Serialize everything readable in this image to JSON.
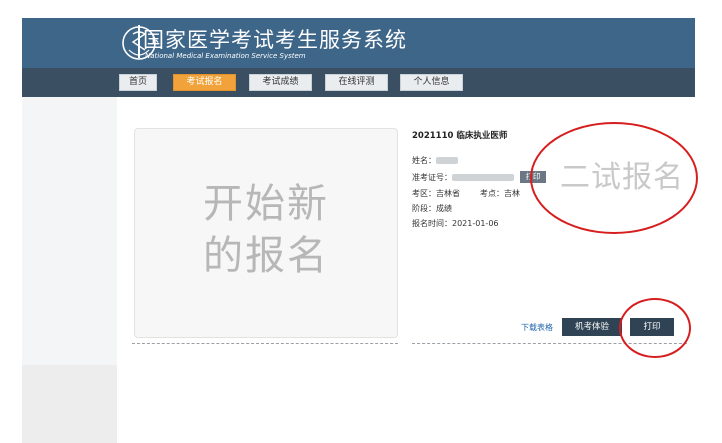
{
  "header": {
    "title_cn": "国家医学考试考生服务系统",
    "title_en": "National Medical Examination Service System"
  },
  "nav": {
    "items": [
      {
        "label": "首页",
        "active": false
      },
      {
        "label": "考试报名",
        "active": true
      },
      {
        "label": "考试成绩",
        "active": false
      },
      {
        "label": "在线评测",
        "active": false
      },
      {
        "label": "个人信息",
        "active": false
      }
    ]
  },
  "new_registration": {
    "line1": "开始新",
    "line2": "的报名"
  },
  "exam": {
    "title": "2021110 临床执业医师",
    "name_label": "姓名：",
    "admission_label": "准考证号：",
    "inline_print_label": "打印",
    "region_label": "考区：",
    "region_value": "吉林省",
    "site_label": "考点：",
    "site_value": "吉林",
    "stage_label": "阶段：",
    "stage_value": "成绩",
    "date_label": "报名时间：",
    "date_value": "2021-01-06"
  },
  "watermark_text": "二试报名",
  "actions": {
    "download_label": "下载表格",
    "cbt_label": "机考体验",
    "print_label": "打印"
  },
  "colors": {
    "header": "#3d6688",
    "navbar": "#3b4f63",
    "active_tab": "#f2a23a",
    "annotation": "#d61e1e"
  }
}
